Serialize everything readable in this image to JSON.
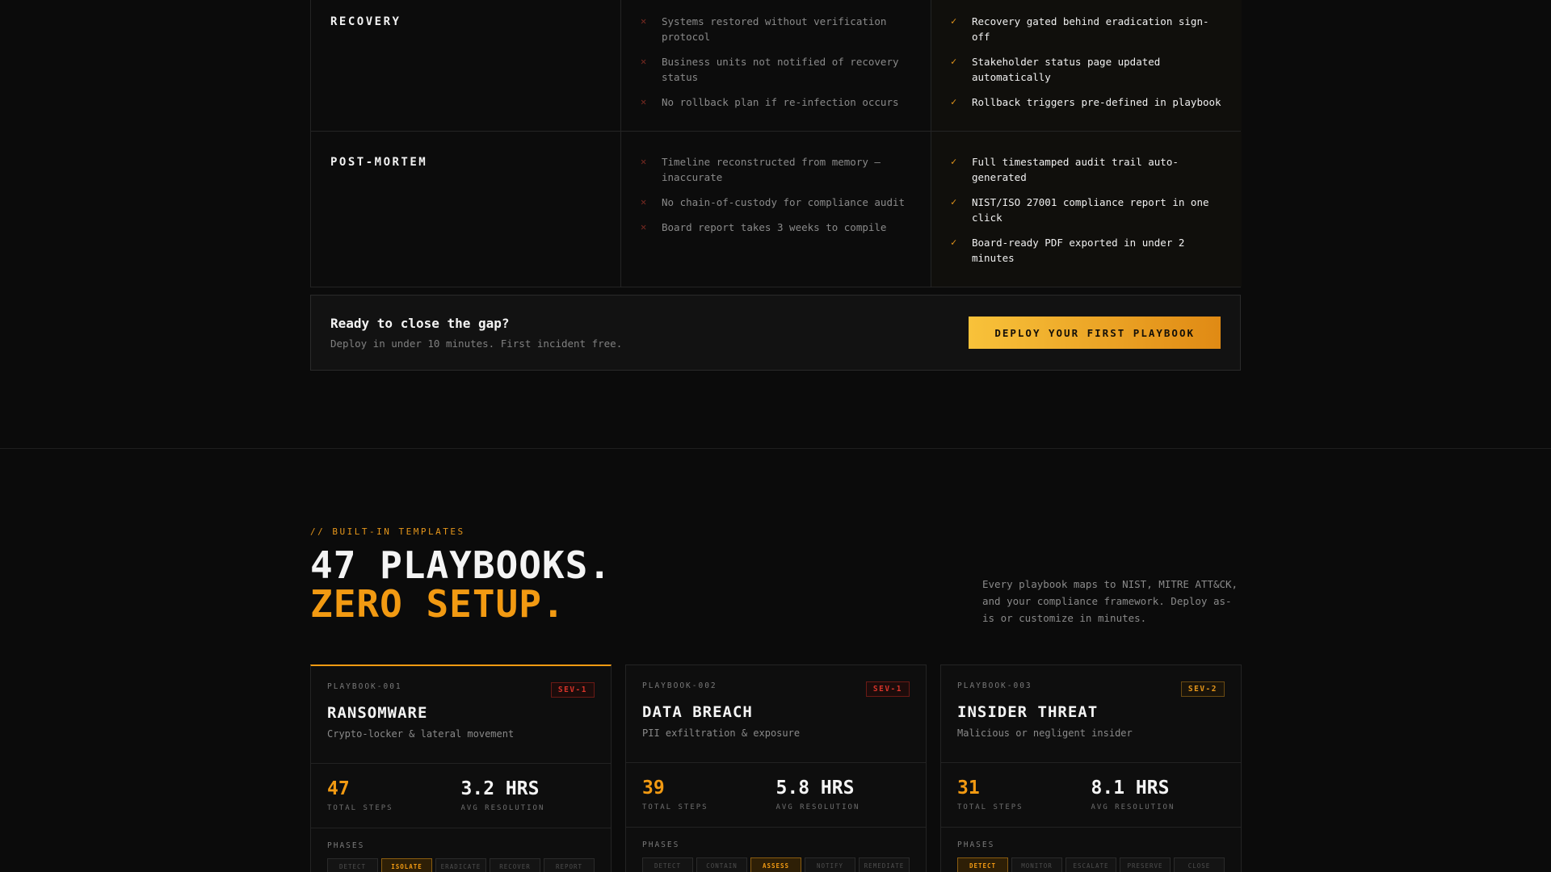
{
  "comparison": {
    "rows": [
      {
        "phase": "RECOVERY",
        "bad": [
          "Systems restored without verification protocol",
          "Business units not notified of recovery status",
          "No rollback plan if re-infection occurs"
        ],
        "good": [
          "Recovery gated behind eradication sign-off",
          "Stakeholder status page updated automatically",
          "Rollback triggers pre-defined in playbook"
        ]
      },
      {
        "phase": "POST-MORTEM",
        "bad": [
          "Timeline reconstructed from memory — inaccurate",
          "No chain-of-custody for compliance audit",
          "Board report takes 3 weeks to compile"
        ],
        "good": [
          "Full timestamped audit trail auto-generated",
          "NIST/ISO 27001 compliance report in one click",
          "Board-ready PDF exported in under 2 minutes"
        ]
      }
    ],
    "bad_icon": "x-icon",
    "good_icon": "check-icon"
  },
  "cta": {
    "title": "Ready to close the gap?",
    "subtitle": "Deploy in under 10 minutes. First incident free.",
    "button": "DEPLOY YOUR FIRST PLAYBOOK"
  },
  "templates": {
    "eyebrow": "// BUILT-IN TEMPLATES",
    "headline_1": "47 PLAYBOOKS.",
    "headline_2": "ZERO SETUP.",
    "description": "Every playbook maps to NIST, MITRE ATT&CK, and your compliance framework. Deploy as-is or customize in minutes.",
    "accent_color": "#f29a12",
    "cards": [
      {
        "id": "PLAYBOOK-001",
        "severity": "SEV-1",
        "name": "RANSOMWARE",
        "subtitle": "Crypto-locker & lateral movement",
        "steps": "47",
        "steps_label": "TOTAL STEPS",
        "resolution": "3.2 HRS",
        "resolution_label": "AVG RESOLUTION",
        "phases_label": "PHASES",
        "phases": [
          "DETECT",
          "ISOLATE",
          "ERADICATE",
          "RECOVER",
          "REPORT"
        ],
        "active_phase": 1
      },
      {
        "id": "PLAYBOOK-002",
        "severity": "SEV-1",
        "name": "DATA BREACH",
        "subtitle": "PII exfiltration & exposure",
        "steps": "39",
        "steps_label": "TOTAL STEPS",
        "resolution": "5.8 HRS",
        "resolution_label": "AVG RESOLUTION",
        "phases_label": "PHASES",
        "phases": [
          "DETECT",
          "CONTAIN",
          "ASSESS",
          "NOTIFY",
          "REMEDIATE"
        ],
        "active_phase": 2
      },
      {
        "id": "PLAYBOOK-003",
        "severity": "SEV-2",
        "name": "INSIDER THREAT",
        "subtitle": "Malicious or negligent insider",
        "steps": "31",
        "steps_label": "TOTAL STEPS",
        "resolution": "8.1 HRS",
        "resolution_label": "AVG RESOLUTION",
        "phases_label": "PHASES",
        "phases": [
          "DETECT",
          "MONITOR",
          "ESCALATE",
          "PRESERVE",
          "CLOSE"
        ],
        "active_phase": 0
      }
    ]
  }
}
